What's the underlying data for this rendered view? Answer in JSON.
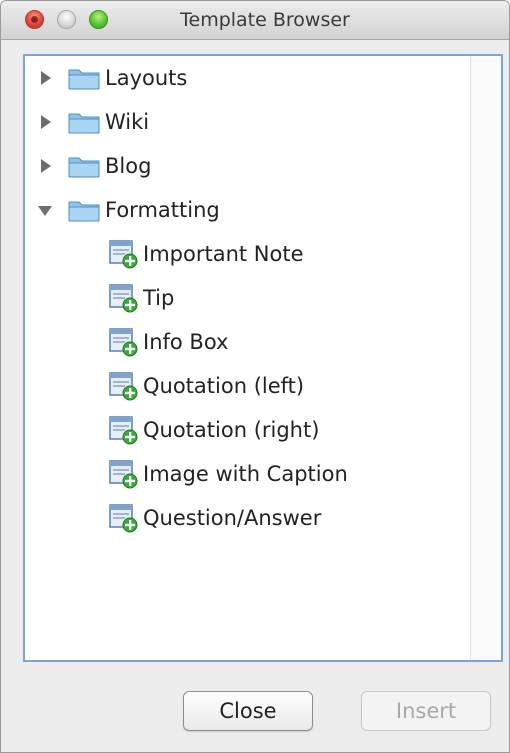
{
  "window": {
    "title": "Template Browser"
  },
  "tree": {
    "folders": [
      {
        "label": "Layouts",
        "expanded": false
      },
      {
        "label": "Wiki",
        "expanded": false
      },
      {
        "label": "Blog",
        "expanded": false
      },
      {
        "label": "Formatting",
        "expanded": true
      }
    ],
    "formatting_items": [
      "Important Note",
      "Tip",
      "Info Box",
      "Quotation (left)",
      "Quotation (right)",
      "Image with Caption",
      "Question/Answer"
    ]
  },
  "buttons": {
    "close_label": "Close",
    "insert_label": "Insert",
    "insert_enabled": false
  },
  "icons": {
    "folder": "folder-icon",
    "template": "template-add-icon",
    "expand": "disclosure-triangle-icon"
  },
  "colors": {
    "focus_border": "#7aa6d6",
    "traffic_close": "#e0443b",
    "traffic_zoom": "#58c62e",
    "disabled_text": "#a8a8a8"
  }
}
